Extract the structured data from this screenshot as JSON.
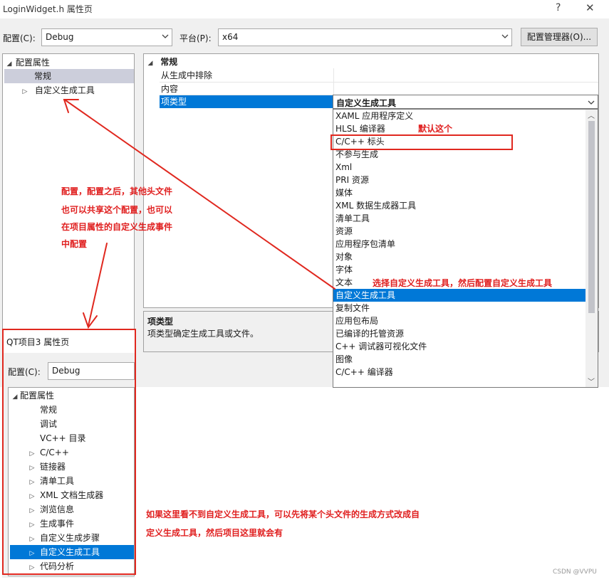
{
  "window": {
    "title": "LoginWidget.h 属性页",
    "help": "?",
    "close": "✕"
  },
  "toolbar": {
    "config_label": "配置(C):",
    "config_value": "Debug",
    "platform_label": "平台(P):",
    "platform_value": "x64",
    "manager_button": "配置管理器(O)..."
  },
  "tree": {
    "root": "配置属性",
    "items": [
      "常规",
      "自定义生成工具"
    ]
  },
  "grid": {
    "section": "常规",
    "rows": [
      "从生成中排除",
      "内容",
      "项类型"
    ],
    "selected_value": "自定义生成工具"
  },
  "dropdown": {
    "options": [
      "XAML 应用程序定义",
      "HLSL 编译器",
      "C/C++ 标头",
      "不参与生成",
      "Xml",
      "PRI 资源",
      "媒体",
      "XML 数据生成器工具",
      "清单工具",
      "资源",
      "应用程序包清单",
      "对象",
      "字体",
      "文本",
      "自定义生成工具",
      "复制文件",
      "应用包布局",
      "已编译的托管资源",
      "C++ 调试器可视化文件",
      "图像",
      "C/C++ 编译器"
    ],
    "highlighted": "自定义生成工具"
  },
  "description": {
    "title": "项类型",
    "text": "项类型确定生成工具或文件。"
  },
  "inset": {
    "title": "QT项目3 属性页",
    "config_label": "配置(C):",
    "config_value": "Debug",
    "tree": [
      "配置属性",
      "常规",
      "调试",
      "VC++ 目录",
      "C/C++",
      "链接器",
      "清单工具",
      "XML 文档生成器",
      "浏览信息",
      "生成事件",
      "自定义生成步骤",
      "自定义生成工具",
      "代码分析"
    ],
    "selected": "自定义生成工具"
  },
  "annotations": {
    "default_note": "默认这个",
    "choose_note": "选择自定义生成工具，然后配置自定义生成工具",
    "left_note": [
      "配置，配置之后，其他头文件",
      "也可以共享这个配置，也可以",
      "在项目属性的自定义生成事件",
      "中配置"
    ],
    "bottom_note": [
      "如果这里看不到自定义生成工具，可以先将某个头文件的生成方式改成自",
      "定义生成工具，然后项目这里就会有"
    ]
  },
  "watermark": "CSDN @VVPU",
  "colors": {
    "selection_blue": "#0078d7",
    "annotation_red": "#e01f1f"
  }
}
